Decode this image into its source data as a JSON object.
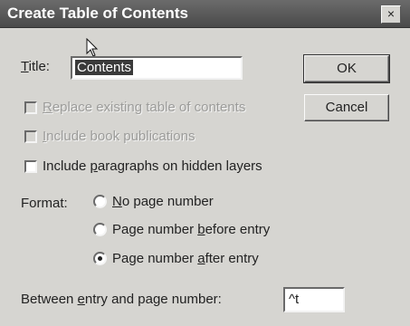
{
  "window": {
    "title": "Create Table of Contents",
    "close_glyph": "×"
  },
  "title_field": {
    "label_t": "T",
    "label_rest": "itle:",
    "value": "Contents"
  },
  "buttons": {
    "ok": "OK",
    "cancel": "Cancel"
  },
  "checkboxes": [
    {
      "pre": "",
      "key": "R",
      "post": "eplace existing table of contents",
      "checked": false,
      "enabled": false
    },
    {
      "pre": "",
      "key": "I",
      "post": "nclude book publications",
      "checked": false,
      "enabled": false
    },
    {
      "pre": "Include ",
      "key": "p",
      "post": "aragraphs on hidden layers",
      "checked": false,
      "enabled": true
    }
  ],
  "format": {
    "label": "Format:",
    "options": [
      {
        "pre": "",
        "key": "N",
        "post": "o page number",
        "selected": false
      },
      {
        "pre": "Page number ",
        "key": "b",
        "post": "efore entry",
        "selected": false
      },
      {
        "pre": "Page number ",
        "key": "a",
        "post": "fter entry",
        "selected": true
      }
    ]
  },
  "between": {
    "pre": "Between ",
    "key": "e",
    "post": "ntry and page number:",
    "value": "^t"
  }
}
